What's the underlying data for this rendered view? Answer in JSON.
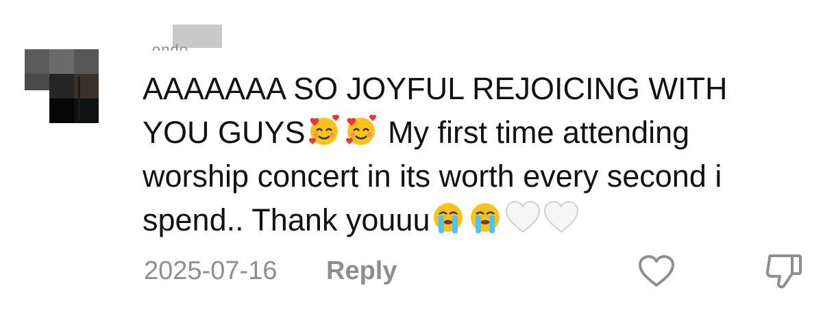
{
  "comment": {
    "author": {
      "username_label": "ondo.",
      "avatar": "pixelated-avatar"
    },
    "text_lines": [
      "AAAAAAA SO JOYFUL REJOICING WITH",
      "YOU GUYS",
      " My first time attending",
      "worship concert in its worth every second i",
      "spend.. Thank youuu"
    ],
    "emojis": {
      "hearts_face": "smiling-face-with-hearts",
      "crying_face": "loudly-crying-face",
      "white_heart": "white-heart"
    },
    "date": "2025-07-16",
    "reply_label": "Reply",
    "icons": {
      "like": "heart-outline-icon",
      "dislike": "thumbs-down-icon"
    }
  }
}
